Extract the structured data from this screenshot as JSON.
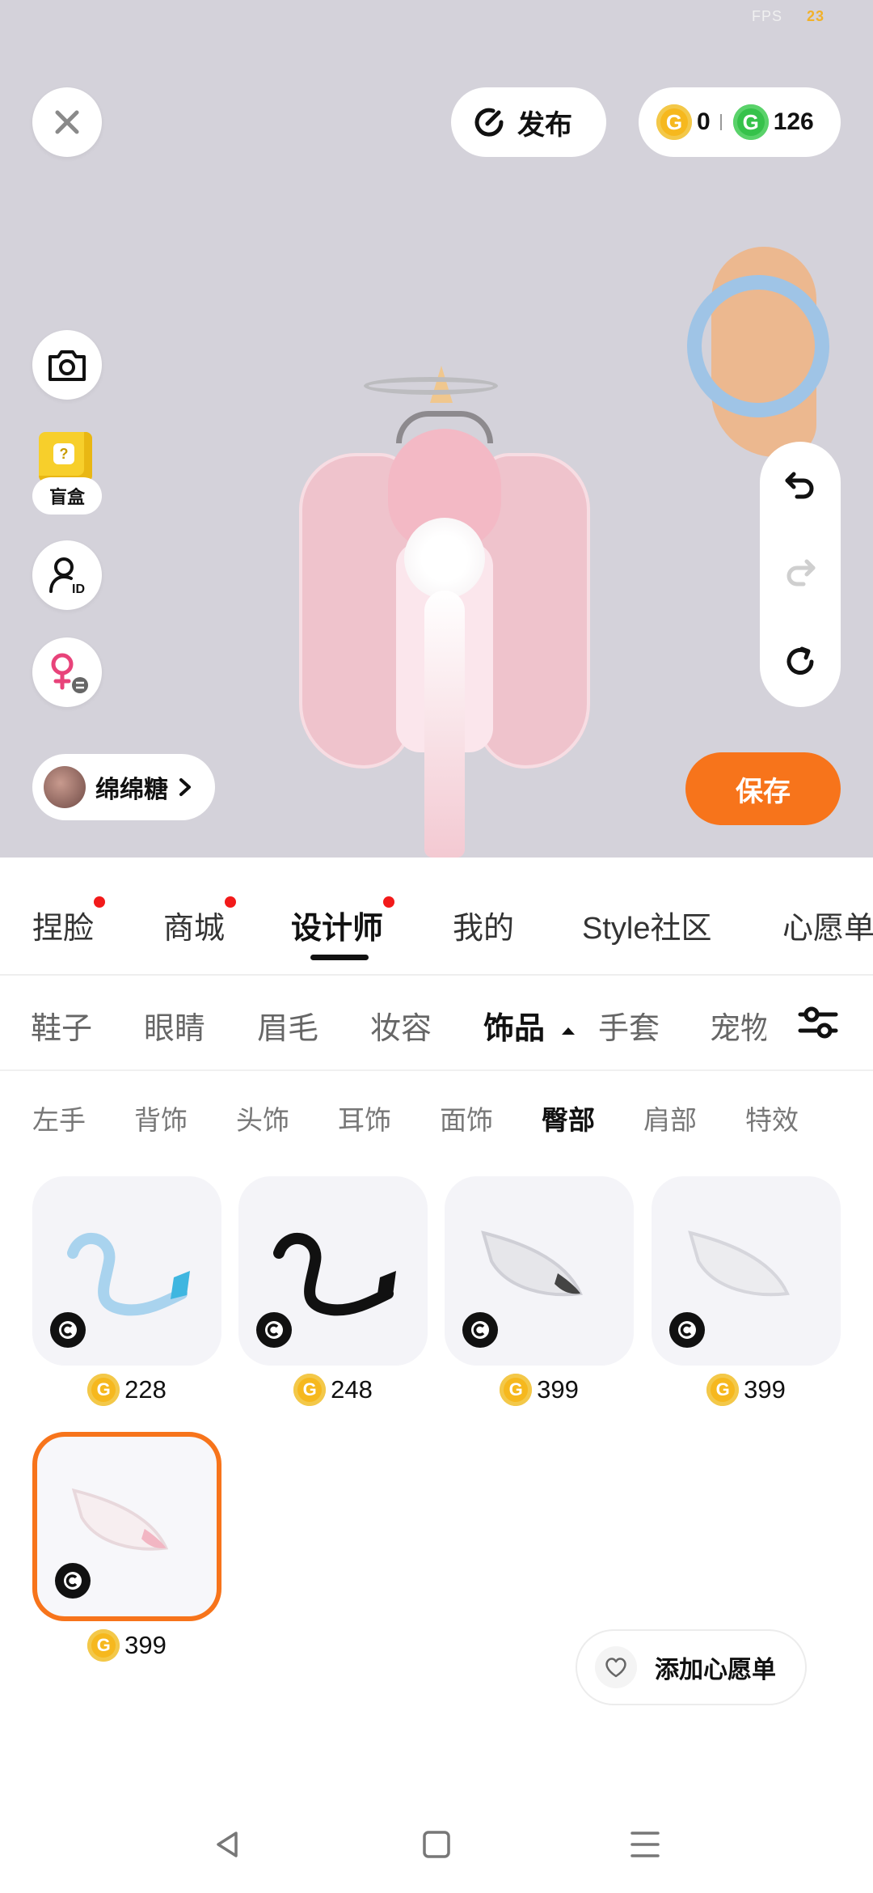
{
  "status": {
    "fps_label": "FPS",
    "fps_value": "23"
  },
  "toolbar": {
    "publish_label": "发布",
    "gold_coin_count": "0",
    "green_coin_count": "126",
    "gold_coin_glyph": "G",
    "green_coin_glyph": "G"
  },
  "left_tools": {
    "blind_box_label": "盲盒"
  },
  "avatar": {
    "name": "绵绵糖"
  },
  "actions": {
    "save_label": "保存"
  },
  "main_tabs": [
    {
      "label": "捏脸",
      "dot": true
    },
    {
      "label": "商城",
      "dot": true
    },
    {
      "label": "设计师",
      "dot": true,
      "active": true
    },
    {
      "label": "我的",
      "dot": false
    },
    {
      "label": "Style社区",
      "dot": false
    },
    {
      "label": "心愿单",
      "dot": false
    }
  ],
  "categories": [
    {
      "label": "鞋子"
    },
    {
      "label": "眼睛"
    },
    {
      "label": "眉毛"
    },
    {
      "label": "妆容"
    },
    {
      "label": "饰品",
      "active": true
    },
    {
      "label": "手套"
    },
    {
      "label": "宠物"
    }
  ],
  "subcategories": [
    {
      "label": "左手"
    },
    {
      "label": "背饰"
    },
    {
      "label": "头饰"
    },
    {
      "label": "耳饰"
    },
    {
      "label": "面饰"
    },
    {
      "label": "臀部",
      "active": true
    },
    {
      "label": "肩部"
    },
    {
      "label": "特效"
    }
  ],
  "items": [
    {
      "price": "228",
      "icon": "blue-tail-icon"
    },
    {
      "price": "248",
      "icon": "black-tail-icon"
    },
    {
      "price": "399",
      "icon": "white-gray-fluffy-tail-icon"
    },
    {
      "price": "399",
      "icon": "white-fluffy-tail-icon"
    },
    {
      "price": "399",
      "icon": "pink-fluffy-tail-icon",
      "selected": true
    }
  ],
  "wishlist": {
    "label": "添加心愿单"
  },
  "colors": {
    "accent": "#f7741b",
    "gold": "#f6b81e",
    "green": "#36c24a",
    "badge_dot": "#f21a1a"
  }
}
